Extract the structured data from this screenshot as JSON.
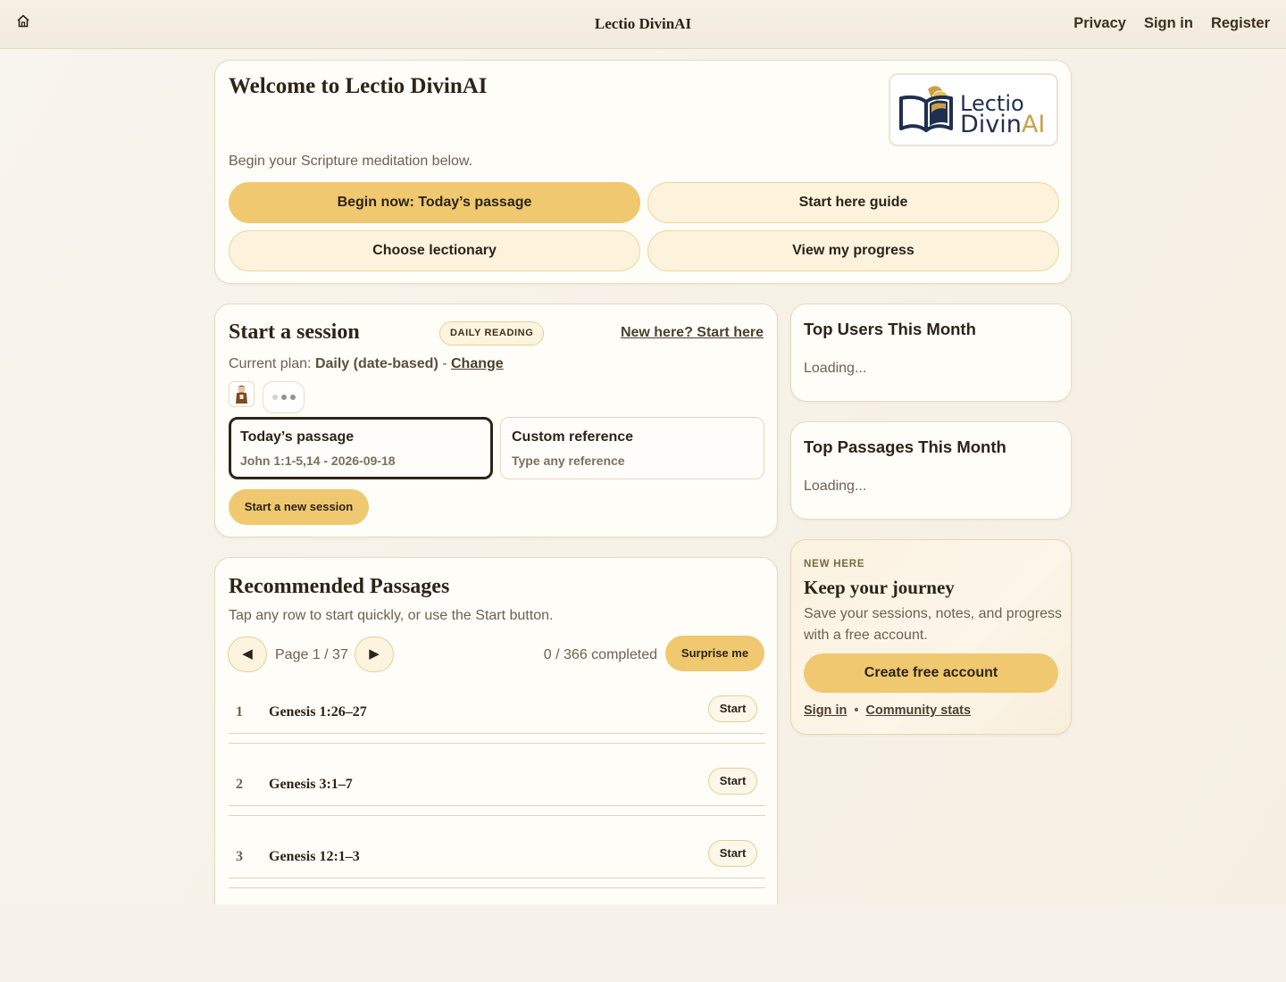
{
  "header": {
    "title": "Lectio DivinAI",
    "nav": [
      "Privacy",
      "Sign in",
      "Register"
    ]
  },
  "welcome": {
    "title": "Welcome to Lectio DivinAI",
    "logo_line1": "Lectio",
    "logo_line2_a": "Divin",
    "logo_line2_b": "AI",
    "subtitle": "Begin your Scripture meditation below.",
    "buttons": {
      "begin": "Begin now: Today’s passage",
      "guide": "Start here guide",
      "lectionary": "Choose lectionary",
      "progress": "View my progress"
    }
  },
  "session": {
    "title": "Start a session",
    "badge": "DAILY READING",
    "new_here": "New here? Start here",
    "plan_label": "Current plan:",
    "plan_value": "Daily (date-based)",
    "plan_sep": "-",
    "change": "Change",
    "choices": [
      {
        "title": "Today’s passage",
        "subtitle": "John 1:1-5,14 - 2026-09-18",
        "selected": true
      },
      {
        "title": "Custom reference",
        "subtitle": "Type any reference",
        "selected": false
      }
    ],
    "start_button": "Start a new session"
  },
  "recommended": {
    "title": "Recommended Passages",
    "subtitle": "Tap any row to start quickly, or use the Start button.",
    "prev_icon": "◀",
    "next_icon": "▶",
    "page_info": "Page 1 / 37",
    "completed": "0 / 366 completed",
    "surprise": "Surprise me",
    "start_label": "Start",
    "rows": [
      {
        "num": "1",
        "ref": "Genesis 1:26–27"
      },
      {
        "num": "2",
        "ref": "Genesis 3:1–7"
      },
      {
        "num": "3",
        "ref": "Genesis 12:1–3"
      }
    ]
  },
  "top_users": {
    "title": "Top Users This Month",
    "status": "Loading..."
  },
  "top_passages": {
    "title": "Top Passages This Month",
    "status": "Loading..."
  },
  "journey": {
    "kicker": "NEW HERE",
    "title": "Keep your journey",
    "description": "Save your sessions, notes, and progress with a free account.",
    "create": "Create free account",
    "sign_in": "Sign in",
    "separator": "•",
    "community": "Community stats"
  },
  "colors": {
    "accent": "#efc870",
    "accent_soft": "#fdf3dd",
    "text": "#2b2418",
    "muted": "#6b6252",
    "logo_navy": "#1f2f4f",
    "logo_gold": "#c9a247"
  },
  "icons": {
    "home": "home-icon",
    "logo": "open-book-logo-icon",
    "avatar": "monk-avatar-icon"
  }
}
